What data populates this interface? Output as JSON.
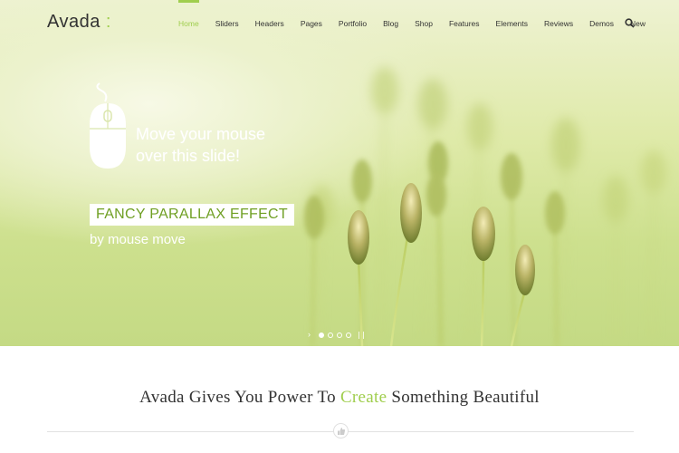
{
  "logo": {
    "text": "Avada",
    "accent": ":"
  },
  "nav": {
    "items": [
      {
        "label": "Home",
        "active": true
      },
      {
        "label": "Sliders"
      },
      {
        "label": "Headers"
      },
      {
        "label": "Pages"
      },
      {
        "label": "Portfolio"
      },
      {
        "label": "Blog"
      },
      {
        "label": "Shop"
      },
      {
        "label": "Features"
      },
      {
        "label": "Elements"
      },
      {
        "label": "Reviews"
      },
      {
        "label": "Demos"
      },
      {
        "label": "New"
      }
    ],
    "search_icon": "search-icon"
  },
  "hero": {
    "line1": "Move your mouse",
    "line2": "over this slide!",
    "fancy_label": "FANCY PARALLAX EFFECT",
    "sub_label": "by mouse move",
    "slider": {
      "dots": 4,
      "active_dot": 1
    }
  },
  "content": {
    "title_pre": "Avada Gives You Power To ",
    "title_highlight": "Create",
    "title_post": " Something Beautiful"
  },
  "colors": {
    "accent": "#a0ce4e",
    "text": "#333333"
  }
}
